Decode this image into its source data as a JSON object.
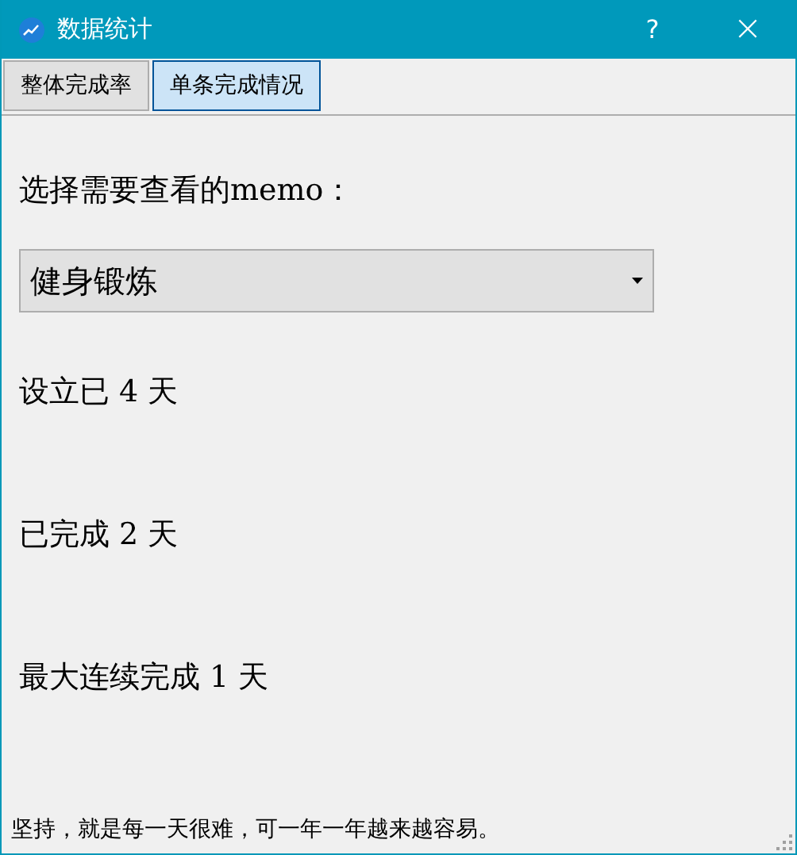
{
  "window": {
    "title": "数据统计",
    "help": "?",
    "close": "×"
  },
  "tabs": [
    {
      "label": "整体完成率",
      "selected": false
    },
    {
      "label": "单条完成情况",
      "selected": true
    }
  ],
  "prompt": "选择需要查看的memo：",
  "memo_select": {
    "value": "健身锻炼"
  },
  "stats": [
    "设立已 4 天",
    "已完成 2 天",
    "最大连续完成 1 天"
  ],
  "status_bar": "坚持，就是每一天很难，可一年一年越来越容易。"
}
